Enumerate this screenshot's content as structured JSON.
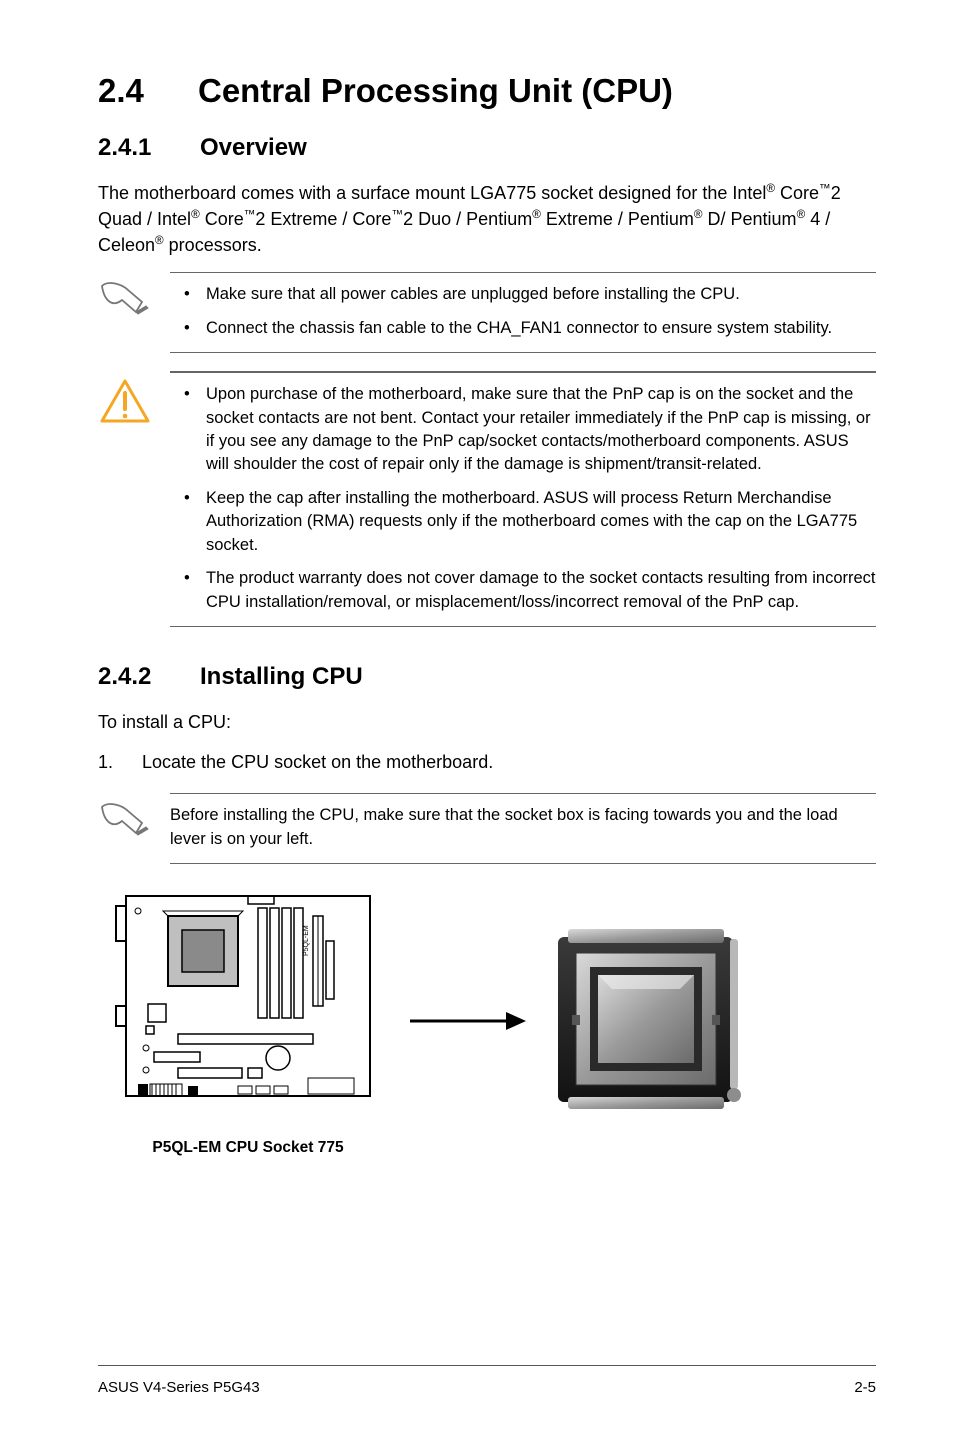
{
  "heading": {
    "num": "2.4",
    "title": "Central Processing Unit (CPU)"
  },
  "sec241": {
    "num": "2.4.1",
    "title": "Overview",
    "para_parts": {
      "p1": "The motherboard comes with a surface mount LGA775 socket designed for the Intel",
      "reg1": "®",
      "p2": " Core",
      "tm1": "™",
      "p3": "2 Quad / Intel",
      "reg2": "®",
      "p4": " Core",
      "tm2": "™",
      "p5": "2 Extreme / Core",
      "tm3": "™",
      "p6": "2 Duo / Pentium",
      "reg3": "®",
      "p7": " Extreme / Pentium",
      "reg4": "®",
      "p8": " D/ Pentium",
      "reg5": "®",
      "p9": " 4 / Celeon",
      "reg6": "®",
      "p10": " processors."
    }
  },
  "note1": {
    "b1": "Make sure that all power cables are unplugged before installing the CPU.",
    "b2": "Connect the chassis fan cable to the CHA_FAN1 connector to ensure system stability."
  },
  "caution": {
    "b1": "Upon purchase of the motherboard, make sure that the PnP cap is on the socket and the socket contacts are not bent. Contact your retailer immediately if the PnP cap is missing, or if you see any damage to the PnP cap/socket contacts/motherboard components. ASUS will shoulder the cost of repair only if the damage is shipment/transit-related.",
    "b2": "Keep the cap after installing the motherboard. ASUS will process Return Merchandise Authorization (RMA) requests only if the motherboard comes with the cap on the LGA775 socket.",
    "b3": "The product warranty does not cover damage to the socket contacts resulting from incorrect CPU installation/removal, or misplacement/loss/incorrect removal of the PnP cap."
  },
  "sec242": {
    "num": "2.4.2",
    "title": "Installing CPU",
    "intro": "To install a CPU:",
    "step1_n": "1.",
    "step1_t": "Locate the CPU socket on the motherboard."
  },
  "note2": "Before installing the CPU, make sure that the socket box is facing towards you and the load lever is on your left.",
  "figure_caption": "P5QL-EM CPU Socket 775",
  "footer": {
    "left": "ASUS V4-Series P5G43",
    "right": "2-5"
  }
}
